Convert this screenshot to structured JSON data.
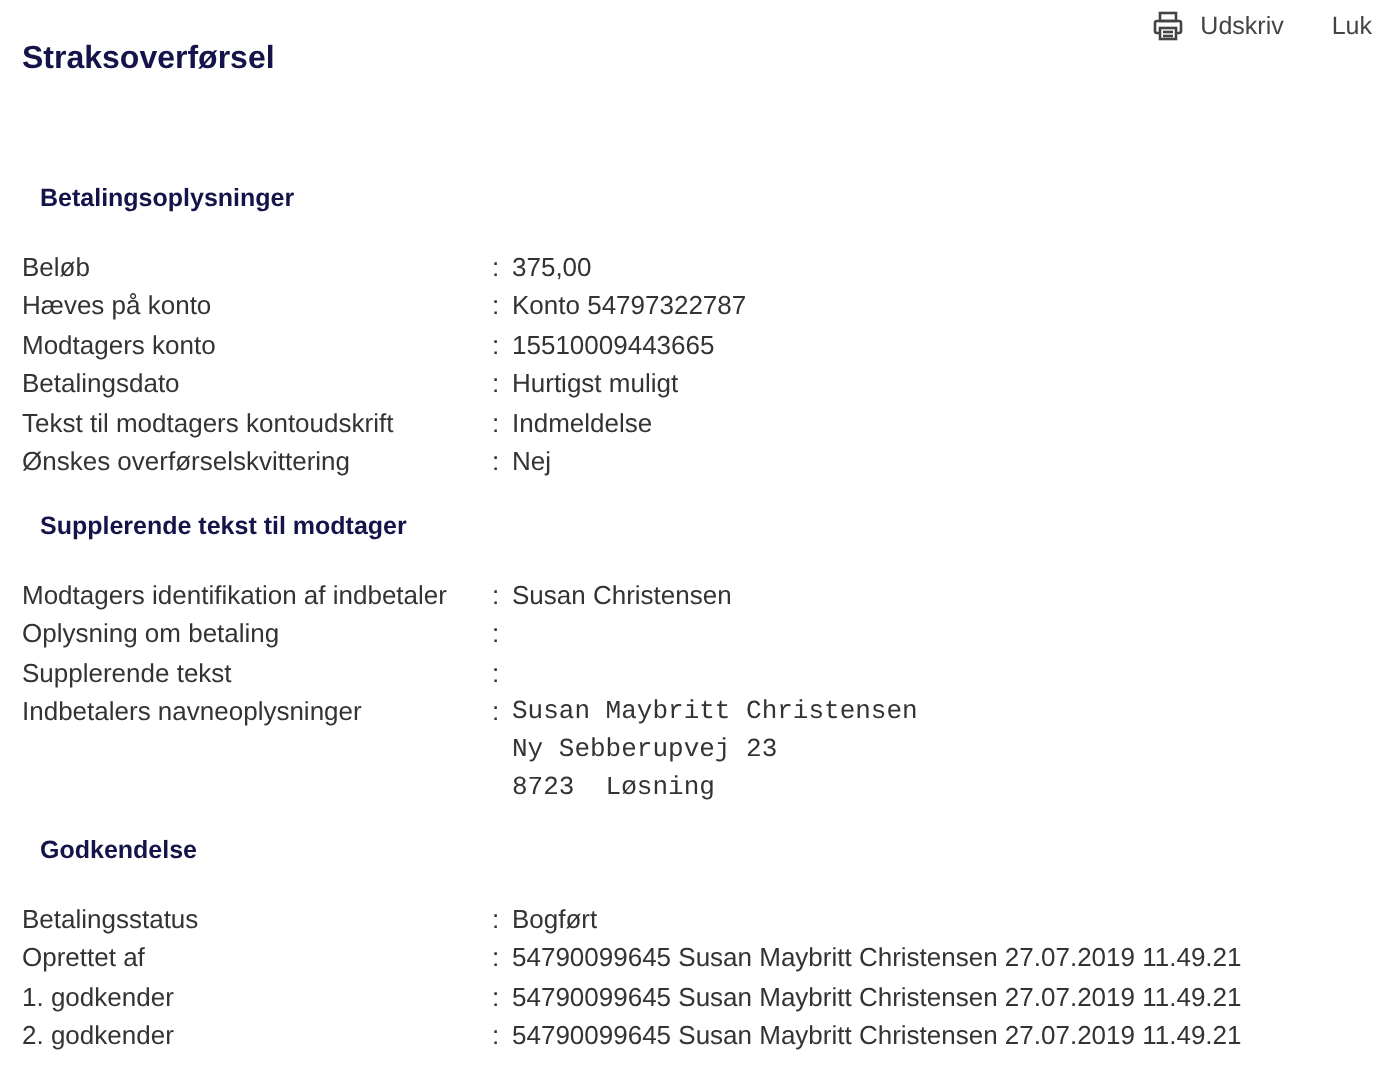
{
  "header": {
    "title": "Straksoverførsel",
    "actions": [
      {
        "kind": "print",
        "label": "Udskriv"
      },
      {
        "kind": "plain",
        "label": "Luk"
      }
    ]
  },
  "sections": [
    {
      "heading": "Betalingsoplysninger",
      "rows": [
        {
          "label": "Beløb",
          "separator": ":",
          "kind": "text",
          "lines": [
            "375,00"
          ]
        },
        {
          "label": "Hæves på konto",
          "separator": ":",
          "kind": "text",
          "lines": [
            "Konto 54797322787"
          ]
        },
        {
          "label": "Modtagers konto",
          "separator": ":",
          "kind": "text",
          "lines": [
            "15510009443665"
          ]
        },
        {
          "label": "Betalingsdato",
          "separator": ":",
          "kind": "text",
          "lines": [
            "Hurtigst muligt"
          ]
        },
        {
          "label": "Tekst til modtagers kontoudskrift",
          "separator": ":",
          "kind": "text",
          "lines": [
            "Indmeldelse"
          ]
        },
        {
          "label": "Ønskes overførselskvittering",
          "separator": ":",
          "kind": "text",
          "lines": [
            "Nej"
          ]
        }
      ]
    },
    {
      "heading": "Supplerende tekst til modtager",
      "rows": [
        {
          "label": "Modtagers identifikation af indbetaler",
          "separator": ":",
          "kind": "text",
          "lines": [
            "Susan Christensen"
          ]
        },
        {
          "label": "Oplysning om betaling",
          "separator": ":",
          "kind": "text",
          "lines": []
        },
        {
          "label": "Supplerende tekst",
          "separator": ":",
          "kind": "text",
          "lines": []
        },
        {
          "label": "Indbetalers navneoplysninger",
          "separator": ":",
          "kind": "mono",
          "lines": [
            "Susan Maybritt Christensen",
            "Ny Sebberupvej 23",
            "8723  Løsning"
          ]
        }
      ]
    },
    {
      "heading": "Godkendelse",
      "rows": [
        {
          "label": "Betalingsstatus",
          "separator": ":",
          "kind": "text",
          "lines": [
            "Bogført"
          ]
        },
        {
          "label": "Oprettet af",
          "separator": ":",
          "kind": "text",
          "lines": [
            "54790099645 Susan Maybritt Christensen 27.07.2019 11.49.21"
          ]
        },
        {
          "label": "1. godkender",
          "separator": ":",
          "kind": "text",
          "lines": [
            "54790099645 Susan Maybritt Christensen 27.07.2019 11.49.21"
          ]
        },
        {
          "label": "2. godkender",
          "separator": ":",
          "kind": "text",
          "lines": [
            "54790099645 Susan Maybritt Christensen 27.07.2019 11.49.21"
          ]
        }
      ]
    }
  ]
}
